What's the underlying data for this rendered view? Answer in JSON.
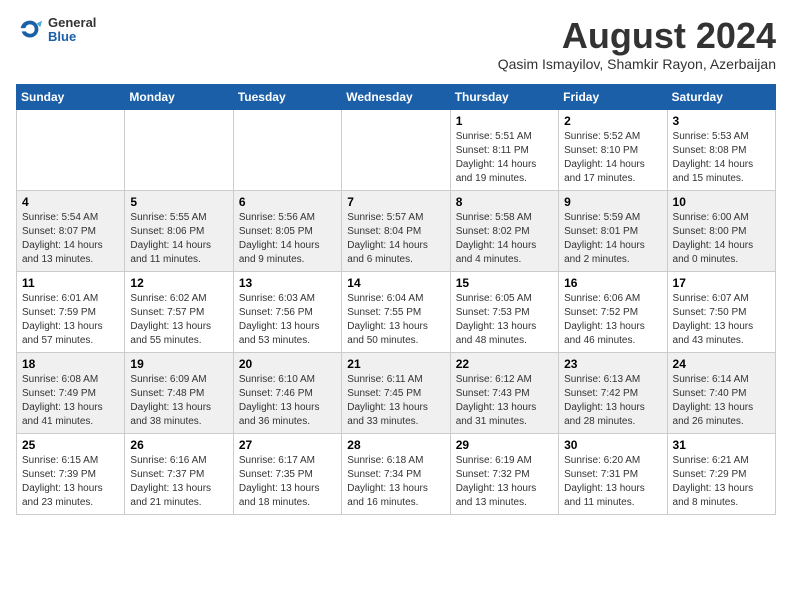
{
  "header": {
    "logo_general": "General",
    "logo_blue": "Blue",
    "month_year": "August 2024",
    "location": "Qasim Ismayilov, Shamkir Rayon, Azerbaijan"
  },
  "weekdays": [
    "Sunday",
    "Monday",
    "Tuesday",
    "Wednesday",
    "Thursday",
    "Friday",
    "Saturday"
  ],
  "weeks": [
    [
      {
        "day": "",
        "info": ""
      },
      {
        "day": "",
        "info": ""
      },
      {
        "day": "",
        "info": ""
      },
      {
        "day": "",
        "info": ""
      },
      {
        "day": "1",
        "info": "Sunrise: 5:51 AM\nSunset: 8:11 PM\nDaylight: 14 hours\nand 19 minutes."
      },
      {
        "day": "2",
        "info": "Sunrise: 5:52 AM\nSunset: 8:10 PM\nDaylight: 14 hours\nand 17 minutes."
      },
      {
        "day": "3",
        "info": "Sunrise: 5:53 AM\nSunset: 8:08 PM\nDaylight: 14 hours\nand 15 minutes."
      }
    ],
    [
      {
        "day": "4",
        "info": "Sunrise: 5:54 AM\nSunset: 8:07 PM\nDaylight: 14 hours\nand 13 minutes."
      },
      {
        "day": "5",
        "info": "Sunrise: 5:55 AM\nSunset: 8:06 PM\nDaylight: 14 hours\nand 11 minutes."
      },
      {
        "day": "6",
        "info": "Sunrise: 5:56 AM\nSunset: 8:05 PM\nDaylight: 14 hours\nand 9 minutes."
      },
      {
        "day": "7",
        "info": "Sunrise: 5:57 AM\nSunset: 8:04 PM\nDaylight: 14 hours\nand 6 minutes."
      },
      {
        "day": "8",
        "info": "Sunrise: 5:58 AM\nSunset: 8:02 PM\nDaylight: 14 hours\nand 4 minutes."
      },
      {
        "day": "9",
        "info": "Sunrise: 5:59 AM\nSunset: 8:01 PM\nDaylight: 14 hours\nand 2 minutes."
      },
      {
        "day": "10",
        "info": "Sunrise: 6:00 AM\nSunset: 8:00 PM\nDaylight: 14 hours\nand 0 minutes."
      }
    ],
    [
      {
        "day": "11",
        "info": "Sunrise: 6:01 AM\nSunset: 7:59 PM\nDaylight: 13 hours\nand 57 minutes."
      },
      {
        "day": "12",
        "info": "Sunrise: 6:02 AM\nSunset: 7:57 PM\nDaylight: 13 hours\nand 55 minutes."
      },
      {
        "day": "13",
        "info": "Sunrise: 6:03 AM\nSunset: 7:56 PM\nDaylight: 13 hours\nand 53 minutes."
      },
      {
        "day": "14",
        "info": "Sunrise: 6:04 AM\nSunset: 7:55 PM\nDaylight: 13 hours\nand 50 minutes."
      },
      {
        "day": "15",
        "info": "Sunrise: 6:05 AM\nSunset: 7:53 PM\nDaylight: 13 hours\nand 48 minutes."
      },
      {
        "day": "16",
        "info": "Sunrise: 6:06 AM\nSunset: 7:52 PM\nDaylight: 13 hours\nand 46 minutes."
      },
      {
        "day": "17",
        "info": "Sunrise: 6:07 AM\nSunset: 7:50 PM\nDaylight: 13 hours\nand 43 minutes."
      }
    ],
    [
      {
        "day": "18",
        "info": "Sunrise: 6:08 AM\nSunset: 7:49 PM\nDaylight: 13 hours\nand 41 minutes."
      },
      {
        "day": "19",
        "info": "Sunrise: 6:09 AM\nSunset: 7:48 PM\nDaylight: 13 hours\nand 38 minutes."
      },
      {
        "day": "20",
        "info": "Sunrise: 6:10 AM\nSunset: 7:46 PM\nDaylight: 13 hours\nand 36 minutes."
      },
      {
        "day": "21",
        "info": "Sunrise: 6:11 AM\nSunset: 7:45 PM\nDaylight: 13 hours\nand 33 minutes."
      },
      {
        "day": "22",
        "info": "Sunrise: 6:12 AM\nSunset: 7:43 PM\nDaylight: 13 hours\nand 31 minutes."
      },
      {
        "day": "23",
        "info": "Sunrise: 6:13 AM\nSunset: 7:42 PM\nDaylight: 13 hours\nand 28 minutes."
      },
      {
        "day": "24",
        "info": "Sunrise: 6:14 AM\nSunset: 7:40 PM\nDaylight: 13 hours\nand 26 minutes."
      }
    ],
    [
      {
        "day": "25",
        "info": "Sunrise: 6:15 AM\nSunset: 7:39 PM\nDaylight: 13 hours\nand 23 minutes."
      },
      {
        "day": "26",
        "info": "Sunrise: 6:16 AM\nSunset: 7:37 PM\nDaylight: 13 hours\nand 21 minutes."
      },
      {
        "day": "27",
        "info": "Sunrise: 6:17 AM\nSunset: 7:35 PM\nDaylight: 13 hours\nand 18 minutes."
      },
      {
        "day": "28",
        "info": "Sunrise: 6:18 AM\nSunset: 7:34 PM\nDaylight: 13 hours\nand 16 minutes."
      },
      {
        "day": "29",
        "info": "Sunrise: 6:19 AM\nSunset: 7:32 PM\nDaylight: 13 hours\nand 13 minutes."
      },
      {
        "day": "30",
        "info": "Sunrise: 6:20 AM\nSunset: 7:31 PM\nDaylight: 13 hours\nand 11 minutes."
      },
      {
        "day": "31",
        "info": "Sunrise: 6:21 AM\nSunset: 7:29 PM\nDaylight: 13 hours\nand 8 minutes."
      }
    ]
  ]
}
